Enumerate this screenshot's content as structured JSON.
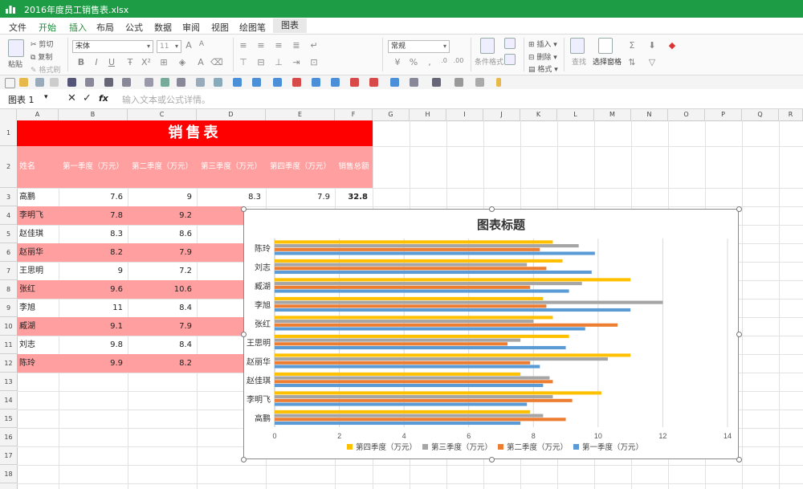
{
  "app": {
    "title": "2016年度员工销售表.xlsx"
  },
  "menu": {
    "items": [
      "文件",
      "开始",
      "插入",
      "布局",
      "公式",
      "数据",
      "审阅",
      "视图",
      "绘图笔"
    ],
    "active": "开始",
    "contextual_tab": "图表"
  },
  "ribbon": {
    "paste": "粘贴",
    "cut": "剪切",
    "copy": "复制",
    "format_painter": "格式刷",
    "font_name": "宋体",
    "font_size": "11",
    "number_format": "常规",
    "cond_format": "条件格式",
    "insert": "插入",
    "delete": "删除",
    "format": "格式",
    "find": "查找",
    "select_pane": "选择窗格"
  },
  "formula_bar": {
    "name_box": "图表 1",
    "cancel_icon": "✕",
    "confirm_icon": "✓",
    "fx": "fx",
    "placeholder": "输入文本或公式详情。"
  },
  "columns": [
    "A",
    "B",
    "C",
    "D",
    "E",
    "F",
    "G",
    "H",
    "I",
    "J",
    "K",
    "L",
    "M",
    "N",
    "O",
    "P",
    "Q",
    "R"
  ],
  "rows": [
    "1",
    "2",
    "3",
    "4",
    "5",
    "6",
    "7",
    "8",
    "9",
    "10",
    "11",
    "12",
    "13",
    "14",
    "15",
    "16",
    "17",
    "18"
  ],
  "table": {
    "title": "销售表",
    "headers": [
      "姓名",
      "第一季度（万元）",
      "第二季度（万元）",
      "第三季度（万元）",
      "第四季度（万元）",
      "销售总额"
    ],
    "rows": [
      [
        "高鹏",
        "7.6",
        "9",
        "8.3",
        "7.9",
        "32.8"
      ],
      [
        "李明飞",
        "7.8",
        "9.2",
        "",
        "",
        ""
      ],
      [
        "赵佳琪",
        "8.3",
        "8.6",
        "",
        "",
        ""
      ],
      [
        "赵丽华",
        "8.2",
        "7.9",
        "",
        "",
        ""
      ],
      [
        "王思明",
        "9",
        "7.2",
        "",
        "",
        ""
      ],
      [
        "张红",
        "9.6",
        "10.6",
        "",
        "",
        ""
      ],
      [
        "李旭",
        "11",
        "8.4",
        "",
        "",
        ""
      ],
      [
        "臧湖",
        "9.1",
        "7.9",
        "",
        "",
        ""
      ],
      [
        "刘志",
        "9.8",
        "8.4",
        "",
        "",
        ""
      ],
      [
        "陈玲",
        "9.9",
        "8.2",
        "",
        "",
        ""
      ]
    ],
    "colors": {
      "title_bg": "#ff0000",
      "header_bg": "#ff9f9f",
      "band_bg": "#ff9f9f",
      "title_text": "#ffffff"
    }
  },
  "chart_data": {
    "type": "bar",
    "orientation": "horizontal",
    "title": "图表标题",
    "categories": [
      "高鹏",
      "李明飞",
      "赵佳琪",
      "赵丽华",
      "王思明",
      "张红",
      "李旭",
      "臧湖",
      "刘志",
      "陈玲"
    ],
    "series": [
      {
        "name": "第一季度（万元）",
        "color": "#5b9bd5",
        "values": [
          7.6,
          7.8,
          8.3,
          8.2,
          9,
          9.6,
          11,
          9.1,
          9.8,
          9.9
        ]
      },
      {
        "name": "第二季度（万元）",
        "color": "#ed7d31",
        "values": [
          9,
          9.2,
          8.6,
          7.9,
          7.2,
          10.6,
          8.4,
          7.9,
          8.4,
          8.2
        ]
      },
      {
        "name": "第三季度（万元）",
        "color": "#a5a5a5",
        "values": [
          8.3,
          8.6,
          8.5,
          10.3,
          7.6,
          8,
          12,
          9.5,
          7.8,
          9.4
        ]
      },
      {
        "name": "第四季度（万元）",
        "color": "#ffc000",
        "values": [
          7.9,
          10.1,
          7.6,
          11,
          9.1,
          8.6,
          8.3,
          11,
          8.9,
          8.6
        ]
      }
    ],
    "xlim": [
      0,
      14
    ],
    "xticks": [
      "0",
      "2",
      "4",
      "6",
      "8",
      "10",
      "12",
      "14"
    ],
    "legend": [
      "第四季度（万元）",
      "第三季度（万元）",
      "第二季度（万元）",
      "第一季度（万元）"
    ],
    "legend_position": "bottom",
    "grid": true
  }
}
